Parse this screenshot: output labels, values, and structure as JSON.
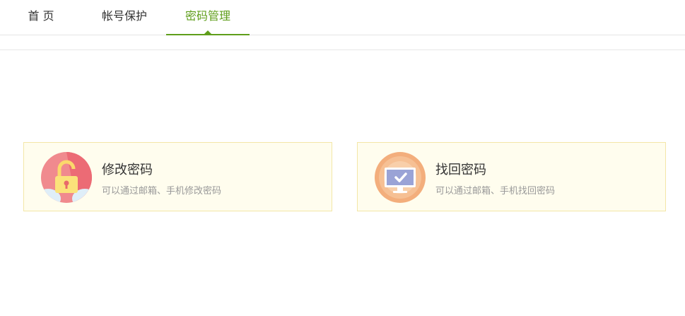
{
  "nav": {
    "tabs": [
      {
        "label": "首 页"
      },
      {
        "label": "帐号保护"
      },
      {
        "label": "密码管理"
      }
    ],
    "active_color": "#5f9e1b"
  },
  "cards": [
    {
      "title": "修改密码",
      "desc": "可以通过邮箱、手机修改密码",
      "icon": "unlock-icon"
    },
    {
      "title": "找回密码",
      "desc": "可以通过邮箱、手机找回密码",
      "icon": "monitor-check-icon"
    }
  ],
  "colors": {
    "card_bg": "#fffdee",
    "card_border": "#f3e6a7"
  }
}
